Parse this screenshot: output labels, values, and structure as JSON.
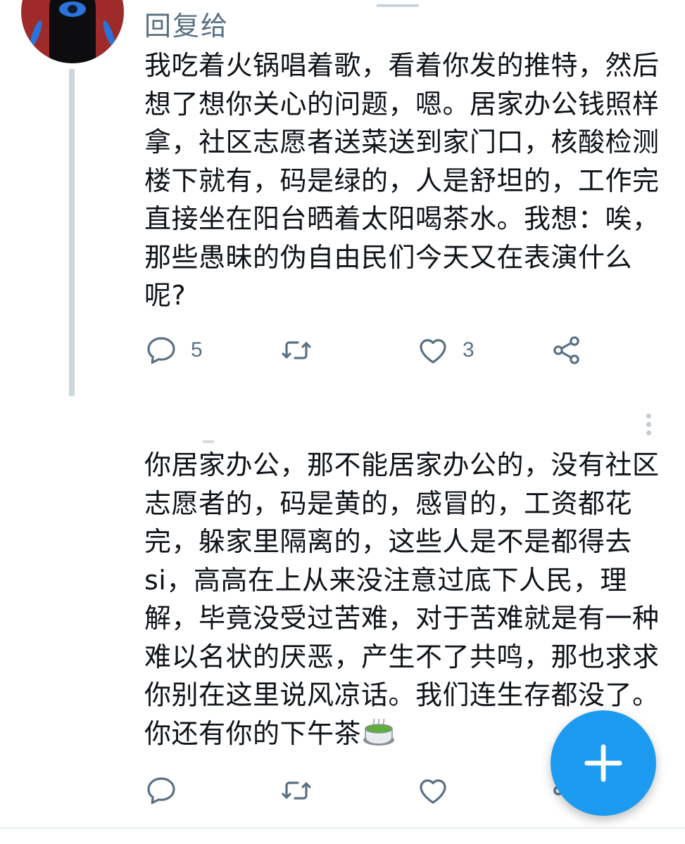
{
  "thread": {
    "reply_to_label": "回复给",
    "tweet1": {
      "text": "我吃着火锅唱着歌，看着你发的推特，然后想了想你关心的问题，嗯。居家办公钱照样拿，社区志愿者送菜送到家门口，核酸检测楼下就有，码是绿的，人是舒坦的，工作完直接坐在阳台晒着太阳喝茶水。我想：唉，那些愚昧的伪自由民们今天又在表演什么呢?",
      "reply_count": "5",
      "retweet_count": "",
      "like_count": "3"
    },
    "tweet2": {
      "text": "你居家办公，那不能居家办公的，没有社区志愿者的，码是黄的，感冒的，工资都花完，躲家里隔离的，这些人是不是都得去si，高高在上从来没注意过底下人民，理解，毕竟没受过苦难，对于苦难就是有一种难以名状的厌恶，产生不了共鸣，那也求求你别在这里说风凉话。我们连生存都没了。你还有你的下午茶",
      "trailing_emoji": "green-tea-emoji",
      "reply_count": "",
      "retweet_count": "",
      "like_count": ""
    }
  },
  "colors": {
    "accent": "#1d9bf0",
    "icon_gray": "#5b7083",
    "text": "#0f1419",
    "thread_line": "#ccd6dd",
    "avatar_red": "#9e2a2a"
  },
  "icons": {
    "reply": "comment-bubble-icon",
    "retweet": "retweet-icon",
    "like": "heart-icon",
    "share": "share-icon",
    "compose": "plus-icon",
    "more": "more-vertical-icon"
  }
}
